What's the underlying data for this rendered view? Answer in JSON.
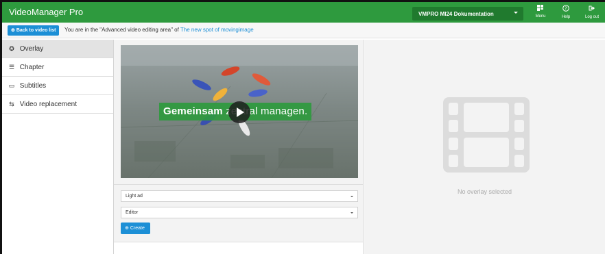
{
  "header": {
    "brand": "VideoManager Pro",
    "channel": "VMPRO MI24 Dokumentation",
    "buttons": [
      {
        "label": "Menu",
        "icon": "grid-icon"
      },
      {
        "label": "Help",
        "icon": "question-icon"
      },
      {
        "label": "Log out",
        "icon": "logout-icon"
      }
    ]
  },
  "subheader": {
    "back_label": "Back to video list",
    "crumb_prefix": "You are in the \"Advanced video editing area\" of",
    "crumb_link": "The new spot of movingimage"
  },
  "sidebar": {
    "items": [
      {
        "label": "Overlay",
        "icon": "overlay-icon",
        "active": true
      },
      {
        "label": "Chapter",
        "icon": "list-icon",
        "active": false
      },
      {
        "label": "Subtitles",
        "icon": "subtitles-icon",
        "active": false
      },
      {
        "label": "Video replacement",
        "icon": "replace-icon",
        "active": false
      }
    ]
  },
  "video": {
    "overlay_bold": "Gemeinsam",
    "overlay_rest": " zentral managen."
  },
  "form": {
    "overlay_type": "Light ad",
    "overlay_source": "Editor",
    "create_label": "Create"
  },
  "preview": {
    "empty_text": "No overlay selected"
  },
  "colors": {
    "brand_green": "#2e9a3e",
    "link_blue": "#1c8fd6"
  }
}
